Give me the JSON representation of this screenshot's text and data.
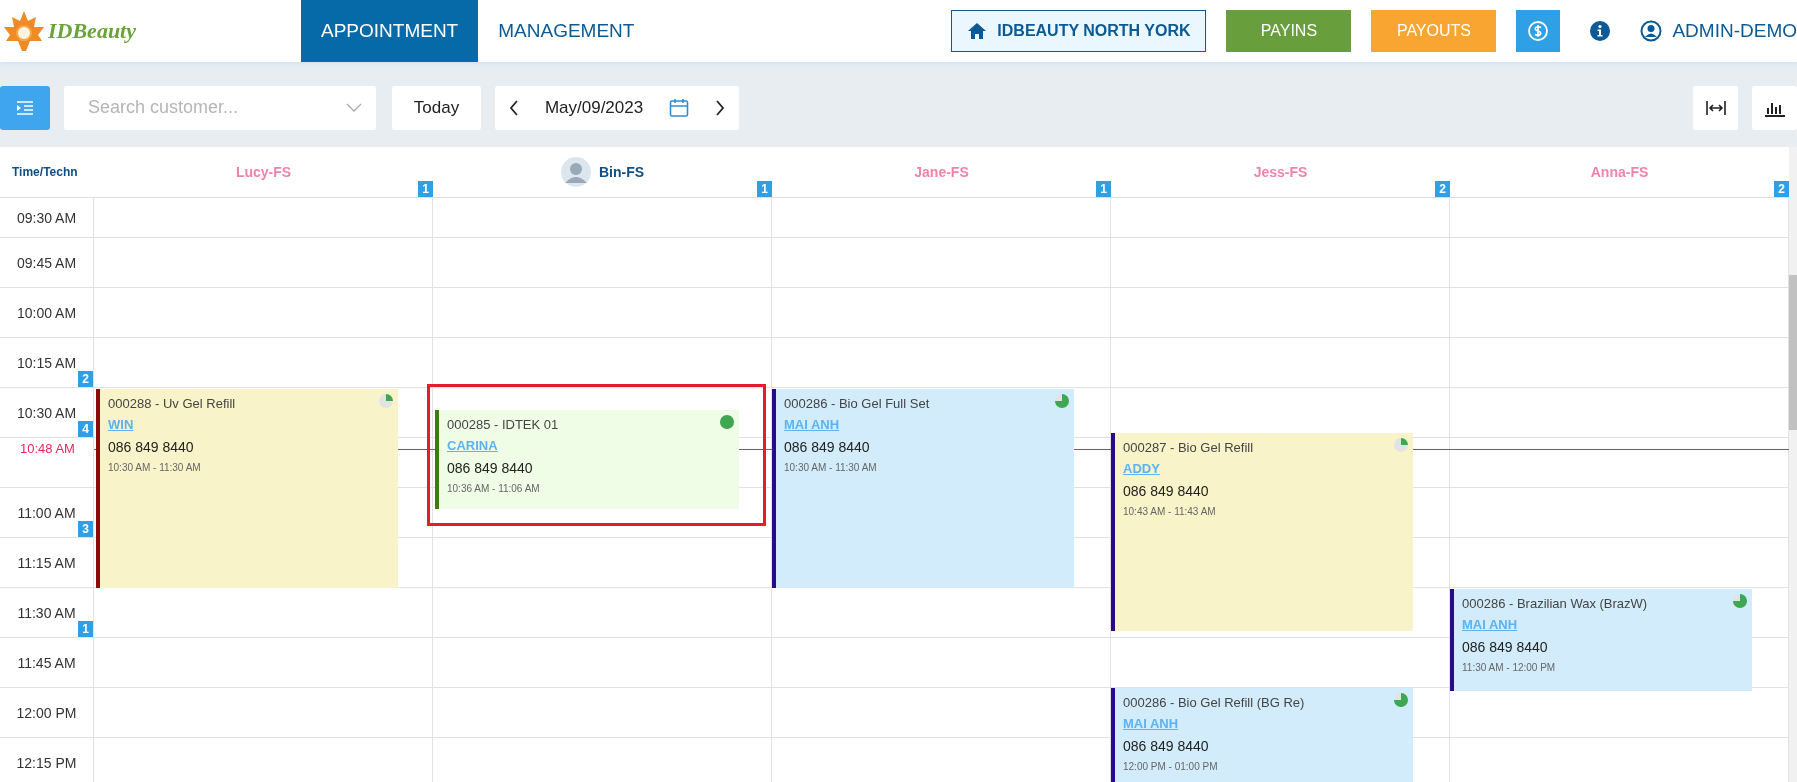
{
  "header": {
    "logo_text": "IDBeauty",
    "nav": [
      {
        "label": "APPOINTMENT",
        "selected": true
      },
      {
        "label": "MANAGEMENT",
        "selected": false
      }
    ],
    "store": "IDBEAUTY NORTH YORK",
    "payins": "PAYINS",
    "payouts": "PAYOUTS",
    "user": "ADMIN-DEMO"
  },
  "toolbar": {
    "search": {
      "placeholder": "Search customer..."
    },
    "today": "Today",
    "date": "May/09/2023"
  },
  "time_heading": "Time/Techn",
  "technicians": [
    {
      "name": "Lucy-FS",
      "count": "1",
      "selected": false
    },
    {
      "name": "Bin-FS",
      "count": "1",
      "selected": true
    },
    {
      "name": "Jane-FS",
      "count": "1",
      "selected": false
    },
    {
      "name": "Jess-FS",
      "count": "2",
      "selected": false
    },
    {
      "name": "Anna-FS",
      "count": "2",
      "selected": false
    }
  ],
  "time_rows": [
    {
      "label": "09:30 AM",
      "kind": "slot"
    },
    {
      "label": "09:45 AM",
      "kind": "slot"
    },
    {
      "label": "10:00 AM",
      "kind": "slot"
    },
    {
      "label": "10:15 AM",
      "kind": "slot",
      "badge": "2"
    },
    {
      "label": "10:30 AM",
      "kind": "slot",
      "badge": "4"
    },
    {
      "label": "10:48 AM",
      "kind": "now"
    },
    {
      "label": "11:00 AM",
      "kind": "slot",
      "badge": "3"
    },
    {
      "label": "11:15 AM",
      "kind": "slot"
    },
    {
      "label": "11:30 AM",
      "kind": "slot",
      "badge": "1"
    },
    {
      "label": "11:45 AM",
      "kind": "slot"
    },
    {
      "label": "12:00 PM",
      "kind": "slot"
    },
    {
      "label": "12:15 PM",
      "kind": "slot"
    }
  ],
  "appointments": [
    {
      "title": "000288 - Uv Gel Refill",
      "customer": "WIN",
      "phone": "086 849 8440",
      "time": "10:30 AM - 11:30 AM",
      "kind": "waiting",
      "color": "#8b0a0a",
      "highlighted": false
    },
    {
      "title": "000285 - IDTEK 01",
      "customer": "CARINA",
      "phone": "086 849 8440",
      "time": "10:36 AM - 11:06 AM",
      "kind": "in_service",
      "color": "#3d7a12",
      "highlighted": true
    },
    {
      "title": "000286 - Bio Gel Full Set",
      "customer": "MAI ANH",
      "phone": "086 849 8440",
      "time": "10:30 AM - 11:30 AM",
      "kind": "confirmed",
      "color": "#2a0a8c",
      "highlighted": false
    },
    {
      "title": "000287 - Bio Gel Refill",
      "customer": "ADDY",
      "phone": "086 849 8440",
      "time": "10:43 AM - 11:43 AM",
      "kind": "waiting",
      "color": "#2a0a8c",
      "highlighted": false
    },
    {
      "title": "000286 - Brazilian Wax (BrazW)",
      "customer": "MAI ANH",
      "phone": "086 849 8440",
      "time": "11:30 AM - 12:00 PM",
      "kind": "confirmed",
      "color": "#2a0a8c",
      "highlighted": false
    },
    {
      "title": "000286 - Bio Gel Refill (BG Re)",
      "customer": "MAI ANH",
      "phone": "086 849 8440",
      "time": "12:00 PM - 01:00 PM",
      "kind": "confirmed",
      "color": "#2a0a8c",
      "highlighted": false
    }
  ]
}
